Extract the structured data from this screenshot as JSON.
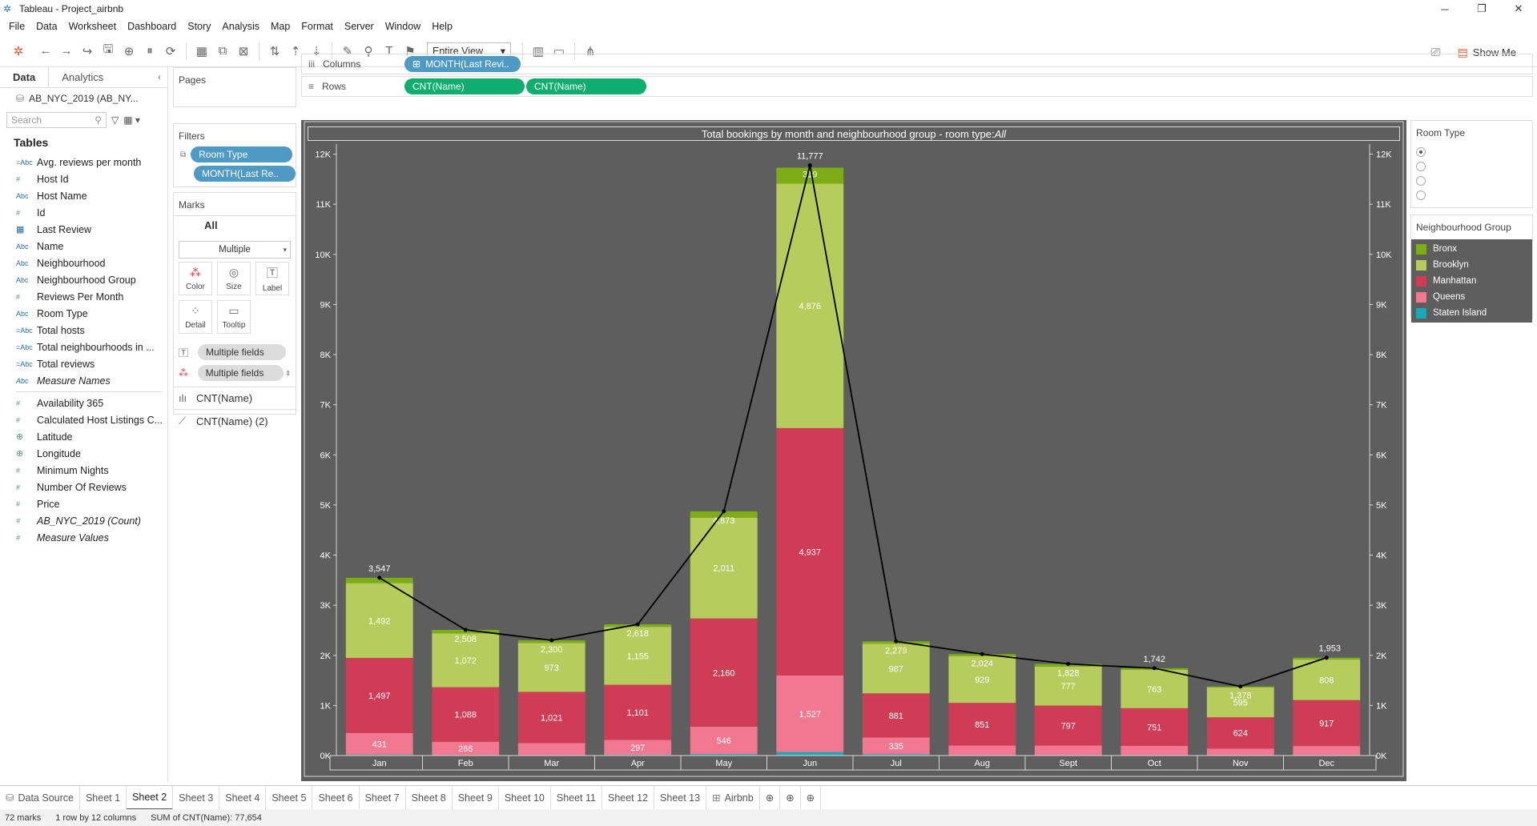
{
  "window": {
    "title": "Tableau - Project_airbnb"
  },
  "menu": [
    "File",
    "Data",
    "Worksheet",
    "Dashboard",
    "Story",
    "Analysis",
    "Map",
    "Format",
    "Server",
    "Window",
    "Help"
  ],
  "toolbar": {
    "fit": "Entire View",
    "show_me": "Show Me"
  },
  "data_pane": {
    "tab_data": "Data",
    "tab_analytics": "Analytics",
    "source": "AB_NYC_2019 (AB_NY...",
    "search_placeholder": "Search",
    "tables_heading": "Tables",
    "dimensions": [
      {
        "type": "abc-calc",
        "name": "Avg. reviews per month"
      },
      {
        "type": "num",
        "name": "Host Id"
      },
      {
        "type": "abc",
        "name": "Host Name"
      },
      {
        "type": "num",
        "name": "Id"
      },
      {
        "type": "date",
        "name": "Last Review"
      },
      {
        "type": "abc",
        "name": "Name"
      },
      {
        "type": "abc",
        "name": "Neighbourhood"
      },
      {
        "type": "abc",
        "name": "Neighbourhood Group"
      },
      {
        "type": "num",
        "name": "Reviews Per Month"
      },
      {
        "type": "abc",
        "name": "Room Type"
      },
      {
        "type": "abc-calc",
        "name": "Total hosts"
      },
      {
        "type": "abc-calc",
        "name": "Total neighbourhoods in ..."
      },
      {
        "type": "abc-calc",
        "name": "Total reviews"
      },
      {
        "type": "abc",
        "name": "Measure Names",
        "italic": true
      }
    ],
    "measures": [
      {
        "type": "num",
        "name": "Availability 365"
      },
      {
        "type": "num",
        "name": "Calculated Host Listings C..."
      },
      {
        "type": "geo",
        "name": "Latitude"
      },
      {
        "type": "geo",
        "name": "Longitude"
      },
      {
        "type": "num",
        "name": "Minimum Nights"
      },
      {
        "type": "num",
        "name": "Number Of Reviews"
      },
      {
        "type": "num",
        "name": "Price"
      },
      {
        "type": "num",
        "name": "AB_NYC_2019 (Count)",
        "italic": true
      },
      {
        "type": "num",
        "name": "Measure Values",
        "italic": true
      }
    ]
  },
  "shelves": {
    "pages": "Pages",
    "filters": "Filters",
    "filter_pills": [
      "Room Type",
      "MONTH(Last Re.."
    ],
    "marks": "Marks",
    "marks_all": "All",
    "mark_type": "Multiple",
    "mark_buttons": [
      "Color",
      "Size",
      "Label",
      "Detail",
      "Tooltip"
    ],
    "mark_fields": [
      "Multiple fields",
      "Multiple fields"
    ],
    "mark_layers": [
      "CNT(Name)",
      "CNT(Name) (2)"
    ],
    "columns_label": "Columns",
    "rows_label": "Rows",
    "columns_pill": "MONTH(Last Revi..",
    "rows_pills": [
      "CNT(Name)",
      "CNT(Name)"
    ]
  },
  "viz": {
    "title_prefix": "Total bookings by month and neighbourhood group - room type:",
    "title_suffix": "All"
  },
  "chart_data": {
    "type": "bar",
    "categories": [
      "Jan",
      "Feb",
      "Mar",
      "Apr",
      "May",
      "Jun",
      "Jul",
      "Aug",
      "Sept",
      "Oct",
      "Nov",
      "Dec"
    ],
    "series": [
      {
        "name": "Staten Island",
        "color": "#1ba7b5",
        "values": [
          20,
          10,
          10,
          15,
          30,
          70,
          25,
          10,
          10,
          10,
          10,
          10
        ]
      },
      {
        "name": "Queens",
        "color": "#f07891",
        "values": [
          431,
          266,
          240,
          297,
          546,
          1527,
          335,
          190,
          190,
          185,
          130,
          180
        ]
      },
      {
        "name": "Manhattan",
        "color": "#d03c55",
        "values": [
          1497,
          1088,
          1021,
          1101,
          2160,
          4937,
          881,
          851,
          797,
          751,
          624,
          917
        ]
      },
      {
        "name": "Brooklyn",
        "color": "#b8cc5e",
        "values": [
          1492,
          1072,
          973,
          1155,
          2011,
          4876,
          987,
          929,
          777,
          763,
          595,
          808
        ]
      },
      {
        "name": "Bronx",
        "color": "#7dad14",
        "values": [
          107,
          72,
          56,
          50,
          126,
          319,
          51,
          44,
          54,
          33,
          19,
          38
        ]
      }
    ],
    "bar_labels": [
      {
        "category": "Jan",
        "values": [
          "431",
          "1,497",
          "1,492"
        ]
      },
      {
        "category": "Feb",
        "values": [
          "266",
          "1,088",
          "1,072",
          "2,508"
        ]
      },
      {
        "category": "Mar",
        "values": [
          "1,021",
          "973",
          "2,300"
        ]
      },
      {
        "category": "Apr",
        "values": [
          "297",
          "1,101",
          "1,155",
          "2,618"
        ]
      },
      {
        "category": "May",
        "values": [
          "546",
          "2,160",
          "2,011",
          "4,873"
        ]
      },
      {
        "category": "Jun",
        "values": [
          "1,527",
          "4,937",
          "4,876",
          "319"
        ]
      },
      {
        "category": "Jul",
        "values": [
          "335",
          "881",
          "987",
          "2,279"
        ]
      },
      {
        "category": "Aug",
        "values": [
          "851",
          "929",
          "2,024"
        ]
      },
      {
        "category": "Sept",
        "values": [
          "797",
          "777",
          "1,828"
        ]
      },
      {
        "category": "Oct",
        "values": [
          "751",
          "763"
        ]
      },
      {
        "category": "Nov",
        "values": [
          "624",
          "595",
          "1,378"
        ]
      },
      {
        "category": "Dec",
        "values": [
          "917",
          "808"
        ]
      }
    ],
    "line": {
      "name": "CNT(Name) (2)",
      "values": [
        3547,
        2508,
        2300,
        2618,
        4873,
        11777,
        2279,
        2024,
        1828,
        1742,
        1378,
        1953
      ],
      "labels": [
        "3,547",
        "",
        "",
        "",
        "",
        "11,777",
        "",
        "",
        "",
        "1,742",
        "",
        "1,953"
      ]
    },
    "y_ticks": [
      "0K",
      "1K",
      "2K",
      "3K",
      "4K",
      "5K",
      "6K",
      "7K",
      "8K",
      "9K",
      "10K",
      "11K",
      "12K"
    ],
    "ylim": [
      0,
      12200
    ]
  },
  "legends": {
    "room_type_title": "Room Type",
    "room_type_options": 4,
    "ng_title": "Neighbourhood Group",
    "ng_items": [
      {
        "label": "Bronx",
        "color": "#7dad14"
      },
      {
        "label": "Brooklyn",
        "color": "#b8cc5e"
      },
      {
        "label": "Manhattan",
        "color": "#d03c55"
      },
      {
        "label": "Queens",
        "color": "#f07891"
      },
      {
        "label": "Staten Island",
        "color": "#1ba7b5"
      }
    ]
  },
  "sheet_tabs": {
    "data_source": "Data Source",
    "sheets": [
      "Sheet 1",
      "Sheet 2",
      "Sheet 3",
      "Sheet 4",
      "Sheet 5",
      "Sheet 6",
      "Sheet 7",
      "Sheet 8",
      "Sheet 9",
      "Sheet 10",
      "Sheet 11",
      "Sheet 12",
      "Sheet 13",
      "Airbnb"
    ],
    "active": "Sheet 2"
  },
  "status": {
    "marks": "72 marks",
    "dims": "1 row by 12 columns",
    "sum": "SUM of CNT(Name): 77,654"
  }
}
